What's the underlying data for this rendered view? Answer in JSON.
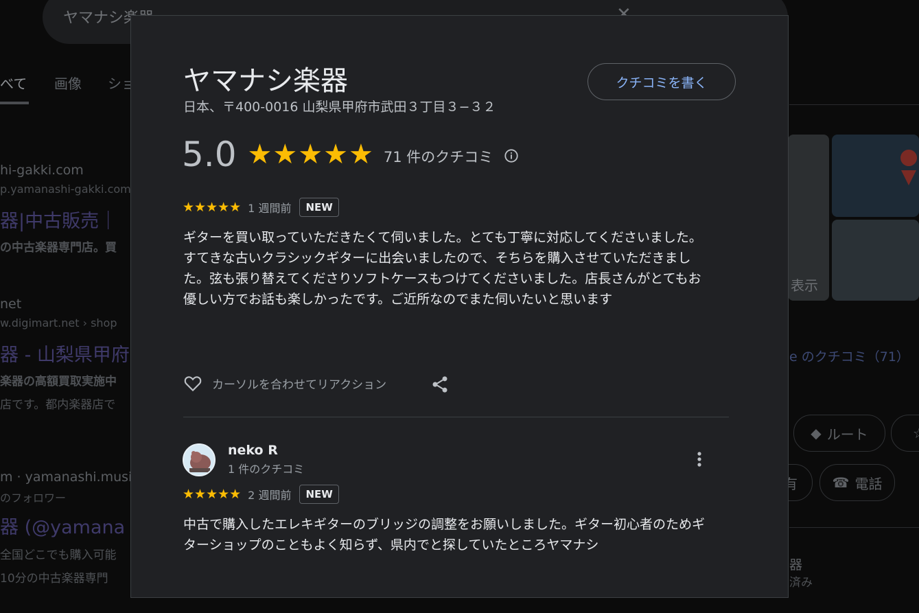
{
  "background": {
    "search_query": "ヤマナシ楽器",
    "tabs": [
      "べて",
      "画像",
      "ショ"
    ],
    "results": [
      {
        "site": "hi-gakki.com",
        "url": "p.yamanashi-gakki.com",
        "title": "器|中古販売｜",
        "snippet": "の中古楽器専門店。買"
      },
      {
        "site": "net",
        "url": "w.digimart.net › shop",
        "title": "器 - 山梨県甲府",
        "snippet1": "楽器の高額買取実施中",
        "snippet2": "店です。都内楽器店で"
      },
      {
        "site": "m · yamanashi.music",
        "url": "のフォロワー",
        "title": "器 (@yamana",
        "snippet1": "全国どこでも購入可能",
        "snippet2": "10分の中古楽器専門"
      }
    ],
    "right_panel": {
      "show_label": "表示",
      "reviews_link": "e のクチコミ（71）",
      "route_label": "ルート",
      "share_label": "有",
      "call_label": "電話",
      "bottom_text1": "器",
      "bottom_text2": "済み"
    }
  },
  "modal": {
    "place_name": "ヤマナシ楽器",
    "address": "日本、〒400-0016 山梨県甲府市武田３丁目３−３２",
    "write_review_label": "クチコミを書く",
    "rating": "5.0",
    "rating_stars": "★★★★★",
    "review_count_label": "71 件のクチコミ",
    "reviews": [
      {
        "stars": "★★★★★",
        "time": "1 週間前",
        "badge": "NEW",
        "text": "ギターを買い取っていただきたくて伺いました。とても丁寧に対応してくださいました。\nすてきな古いクラシックギターに出会いましたので、そちらを購入させていただきました。弦も張り替えてくださりソフトケースもつけてくださいました。店長さんがとてもお優しい方でお話も楽しかったです。ご近所なのでまた伺いたいと思います",
        "reaction_label": "カーソルを合わせてリアクション"
      },
      {
        "author": "neko R",
        "author_review_count": "1 件のクチコミ",
        "stars": "★★★★★",
        "time": "2 週間前",
        "badge": "NEW",
        "text": "中古で購入したエレキギターのブリッジの調整をお願いしました。ギター初心者のためギターショップのこともよく知らず、県内でと探していたところヤマナシ"
      }
    ]
  },
  "colors": {
    "star": "#fbbc04",
    "link": "#8ab4f8",
    "modal_bg": "#202124"
  }
}
